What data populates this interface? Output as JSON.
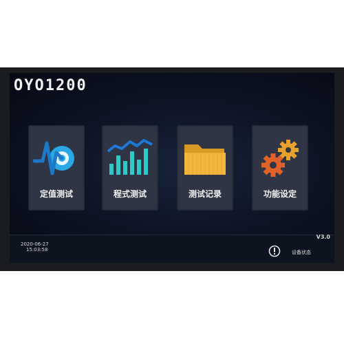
{
  "app": {
    "brand": "OYO1200",
    "version": "V3.0"
  },
  "tiles": [
    {
      "label": "定值测试",
      "icon": "waveform-dial-icon"
    },
    {
      "label": "程式测试",
      "icon": "bar-chart-icon"
    },
    {
      "label": "测试记录",
      "icon": "folder-icon"
    },
    {
      "label": "功能设定",
      "icon": "gears-icon"
    }
  ],
  "status_bar": {
    "date": "2020-06-27",
    "time": "15:03:58",
    "status_label": "设备状态",
    "alert_icon": "exclamation-circle-icon"
  },
  "colors": {
    "accent_blue": "#2aa8e6",
    "folder_yellow": "#f2b63c",
    "gear_orange": "#e0622a",
    "gear_yellow": "#e8a12d"
  }
}
